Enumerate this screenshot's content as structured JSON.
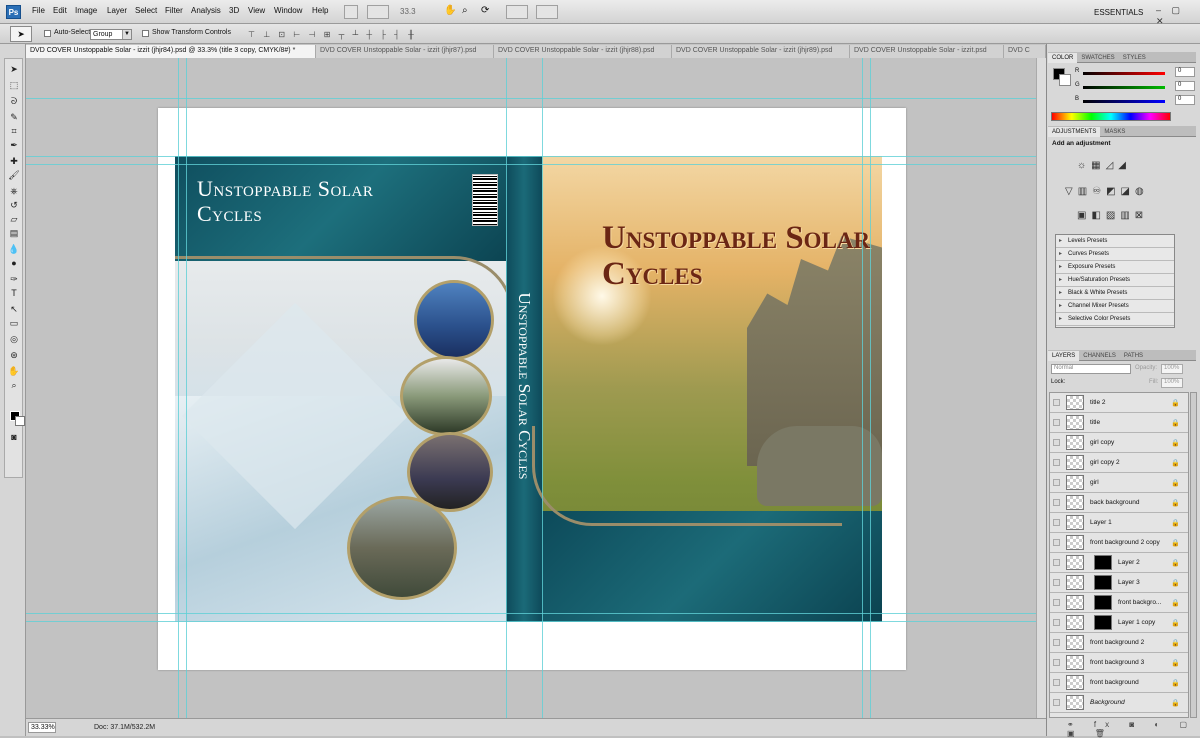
{
  "menubar": {
    "logo": "Ps",
    "items": [
      "File",
      "Edit",
      "Image",
      "Layer",
      "Select",
      "Filter",
      "Analysis",
      "3D",
      "View",
      "Window",
      "Help"
    ],
    "zoom": "33.3",
    "workspace": "ESSENTIALS",
    "window_controls": "‒ ▢ ✕"
  },
  "options": {
    "tool_glyph": "➤",
    "auto_select_label": "Auto-Select:",
    "auto_select_value": "Group",
    "show_transform_label": "Show Transform Controls",
    "align_glyphs": "⊤ ⊥ ⊡ ⊢ ⊣ ⊞ ┬ ┴ ┼ ├ ┤ ╫"
  },
  "tabs": [
    {
      "label": "DVD COVER Unstoppable Solar - izzit (jhjr84).psd @ 33.3% (title 3 copy, CMYK/8#) *",
      "active": true
    },
    {
      "label": "DVD COVER Unstoppable Solar - izzit (jhjr87).psd",
      "active": false
    },
    {
      "label": "DVD COVER Unstoppable Solar - izzit (jhjr88).psd",
      "active": false
    },
    {
      "label": "DVD COVER Unstoppable Solar - izzit (jhjr89).psd",
      "active": false
    },
    {
      "label": "DVD COVER Unstoppable Solar - izzit.psd",
      "active": false
    },
    {
      "label": "DVD C",
      "active": false
    }
  ],
  "document": {
    "back_title": "Unstoppable Solar Cycles",
    "spine_title": "Unstoppable Solar Cycles",
    "front_title": "Unstoppable Solar Cycles",
    "barcode_number": "7 18122 23062 4"
  },
  "status": {
    "zoom": "33.33%",
    "doc": "Doc: 37.1M/532.2M"
  },
  "color_panel": {
    "tabs": [
      "COLOR",
      "SWATCHES",
      "STYLES"
    ],
    "channels": [
      {
        "label": "R",
        "value": "0",
        "color": "#ff0000"
      },
      {
        "label": "G",
        "value": "0",
        "color": "#00b000"
      },
      {
        "label": "B",
        "value": "0",
        "color": "#0000ff"
      }
    ]
  },
  "adjustments": {
    "tabs": [
      "ADJUSTMENTS",
      "MASKS"
    ],
    "title": "Add an adjustment",
    "presets": [
      "Levels Presets",
      "Curves Presets",
      "Exposure Presets",
      "Hue/Saturation Presets",
      "Black & White Presets",
      "Channel Mixer Presets",
      "Selective Color Presets"
    ]
  },
  "layers_panel": {
    "tabs": [
      "LAYERS",
      "CHANNELS",
      "PATHS"
    ],
    "blend_mode": "Normal",
    "opacity_label": "Opacity:",
    "opacity": "100%",
    "lock_label": "Lock:",
    "fill_label": "Fill:",
    "fill": "100%",
    "layers": [
      {
        "name": "title 2",
        "mask": false
      },
      {
        "name": "title",
        "mask": false
      },
      {
        "name": "girl copy",
        "mask": false
      },
      {
        "name": "girl copy 2",
        "mask": false
      },
      {
        "name": "girl",
        "mask": false
      },
      {
        "name": "back background",
        "mask": false
      },
      {
        "name": "Layer 1",
        "mask": false
      },
      {
        "name": "front background 2 copy",
        "mask": false
      },
      {
        "name": "Layer 2",
        "mask": true
      },
      {
        "name": "Layer 3",
        "mask": true
      },
      {
        "name": "front backgro...",
        "mask": true
      },
      {
        "name": "Layer 1 copy",
        "mask": true
      },
      {
        "name": "front background 2",
        "mask": false
      },
      {
        "name": "front background 3",
        "mask": false
      },
      {
        "name": "front background",
        "mask": false
      },
      {
        "name": "Background",
        "mask": false
      }
    ],
    "footer_glyphs": "⚭ fx ◙ ◐ ▢ ▣ 🗑"
  }
}
